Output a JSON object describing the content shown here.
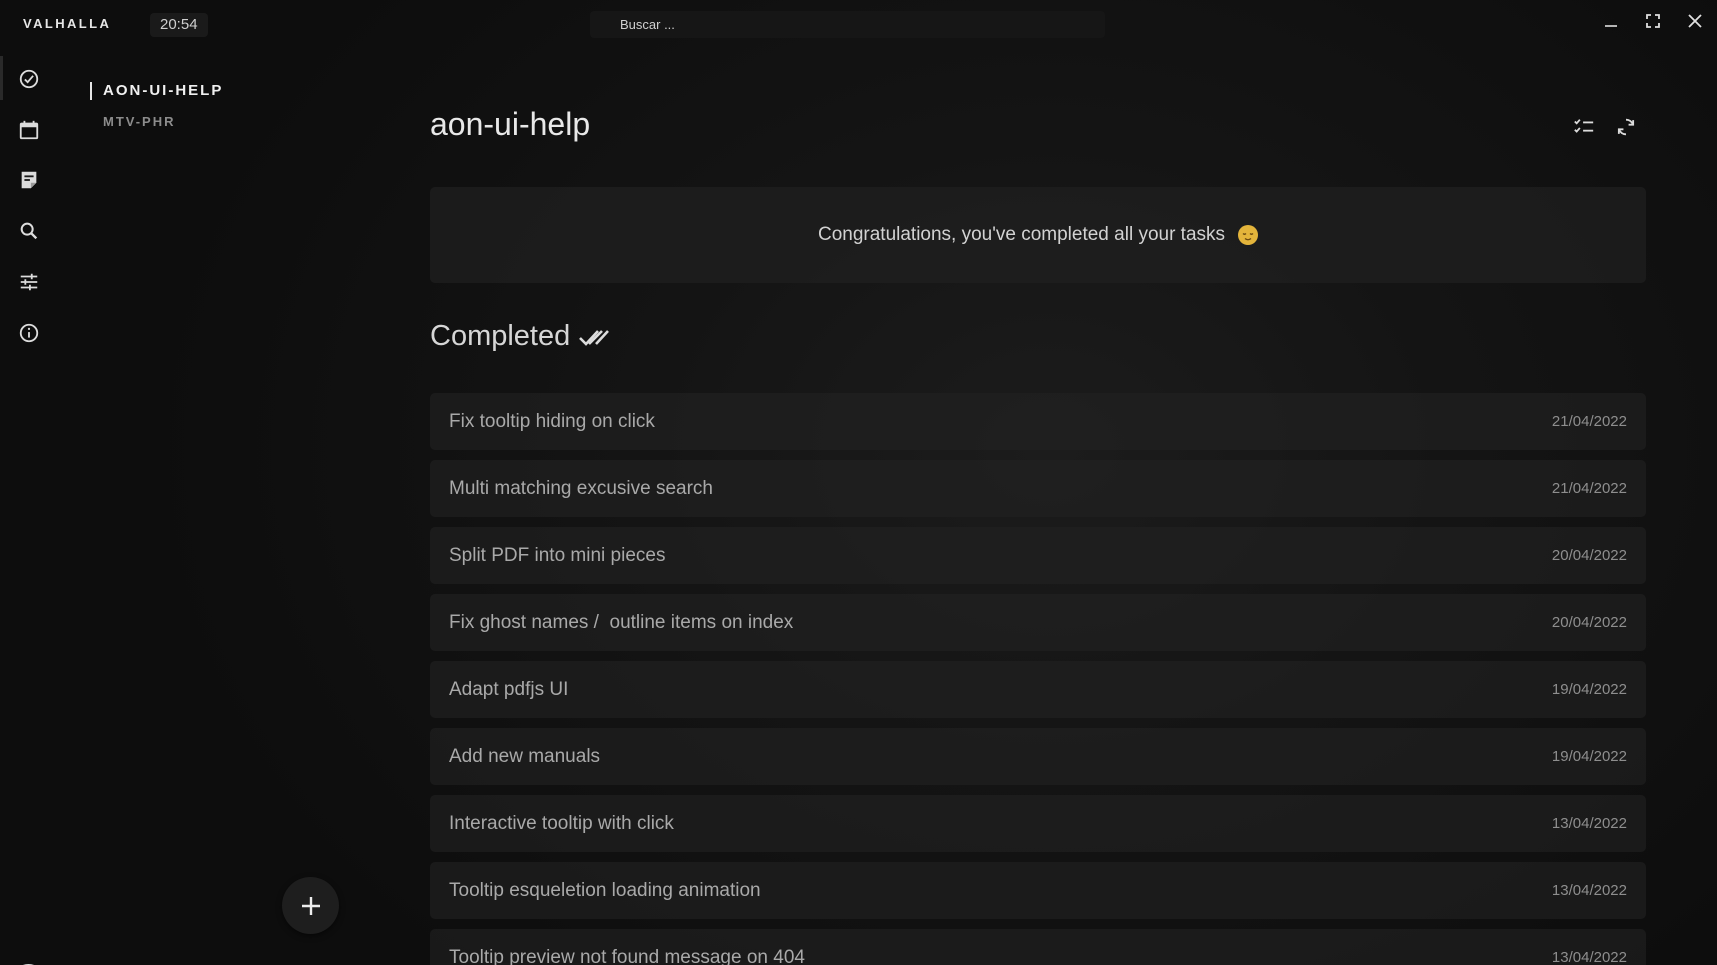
{
  "app": {
    "brand": "VALHALLA",
    "clock": "20:54"
  },
  "search": {
    "placeholder": "Buscar ..."
  },
  "window_controls": [
    "minimize-icon",
    "maximize-icon",
    "close-icon"
  ],
  "rail": {
    "icons": [
      "check-circle-icon",
      "calendar-icon",
      "notes-icon",
      "search-icon",
      "sliders-icon",
      "info-icon"
    ],
    "active_index": 0
  },
  "projects": [
    {
      "label": "AON-UI-HELP",
      "active": true
    },
    {
      "label": "MTV-PHR",
      "active": false
    }
  ],
  "main": {
    "title": "aon-ui-help",
    "congrats": "Congratulations, you've completed all your tasks",
    "completed_heading": "Completed"
  },
  "tasks": [
    {
      "title": "Fix tooltip hiding on click",
      "date": "21/04/2022"
    },
    {
      "title": "Multi matching excusive search",
      "date": "21/04/2022"
    },
    {
      "title": "Split PDF into mini pieces",
      "date": "20/04/2022"
    },
    {
      "title": "Fix ghost names /  outline items on index",
      "date": "20/04/2022"
    },
    {
      "title": "Adapt pdfjs UI",
      "date": "19/04/2022"
    },
    {
      "title": "Add new manuals",
      "date": "19/04/2022"
    },
    {
      "title": "Interactive tooltip with click",
      "date": "13/04/2022"
    },
    {
      "title": "Tooltip esqueletion loading animation",
      "date": "13/04/2022"
    },
    {
      "title": "Tooltip preview not found message on 404",
      "date": "13/04/2022"
    }
  ],
  "colors": {
    "background": "#0f0f0f",
    "card": "#222222",
    "text": "#d6d6d6",
    "muted": "#8e8e8e",
    "emoji": "#e3b43b"
  }
}
